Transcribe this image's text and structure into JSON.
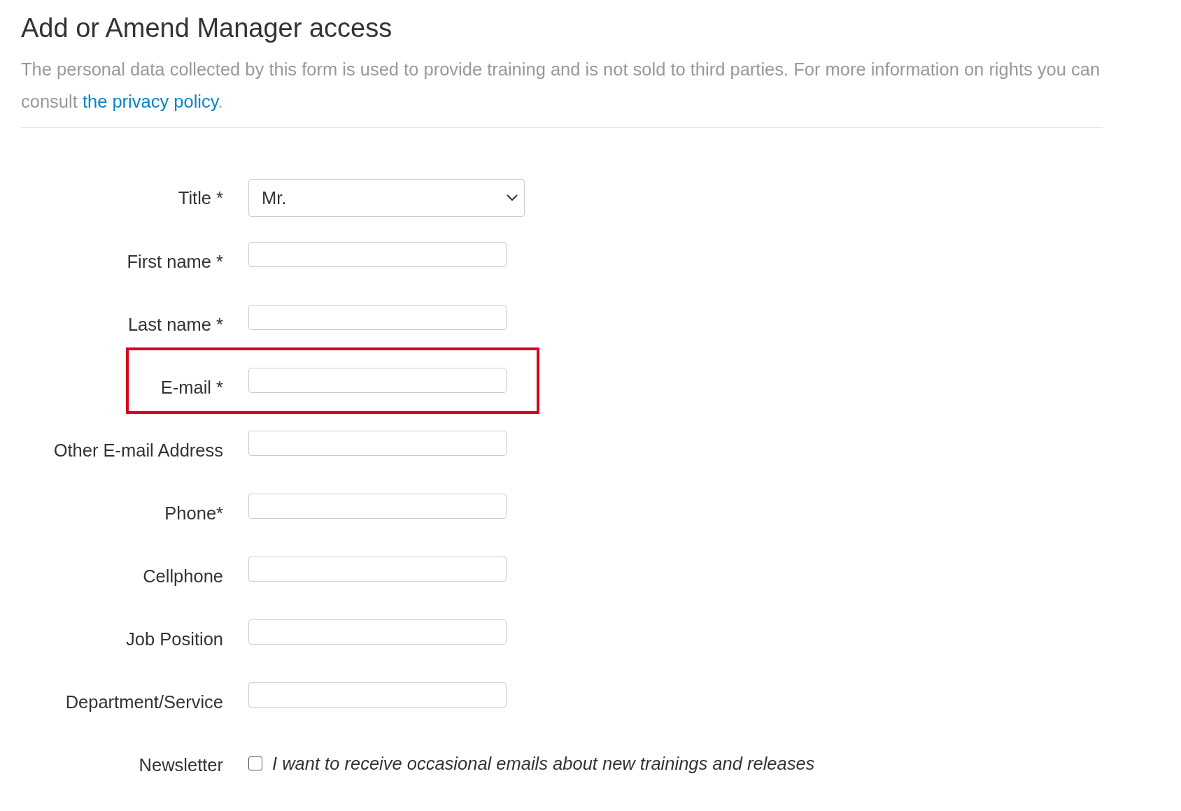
{
  "heading": "Add or Amend Manager access",
  "notice": {
    "text": "The personal data collected by this form is used to provide training and is not sold to third parties. For more information on rights you can consult ",
    "link": "the privacy policy",
    "after": "."
  },
  "fields": [
    {
      "label": "Title *",
      "kind": "select",
      "value": "Mr.",
      "highlighted": false
    },
    {
      "label": "First name *",
      "kind": "text",
      "highlighted": false
    },
    {
      "label": "Last name *",
      "kind": "text",
      "highlighted": false
    },
    {
      "label": "E-mail *",
      "kind": "text",
      "highlighted": true
    },
    {
      "label": "Other E-mail Address",
      "kind": "text",
      "highlighted": false
    },
    {
      "label": "Phone*",
      "kind": "text",
      "highlighted": false
    },
    {
      "label": "Cellphone",
      "kind": "text",
      "highlighted": false
    },
    {
      "label": "Job Position",
      "kind": "text",
      "highlighted": false
    },
    {
      "label": "Department/Service",
      "kind": "text",
      "highlighted": false
    },
    {
      "label": "Newsletter",
      "kind": "checkbox",
      "text": "I want to receive occasional emails about new trainings and releases",
      "checked": false,
      "highlighted": false
    }
  ]
}
